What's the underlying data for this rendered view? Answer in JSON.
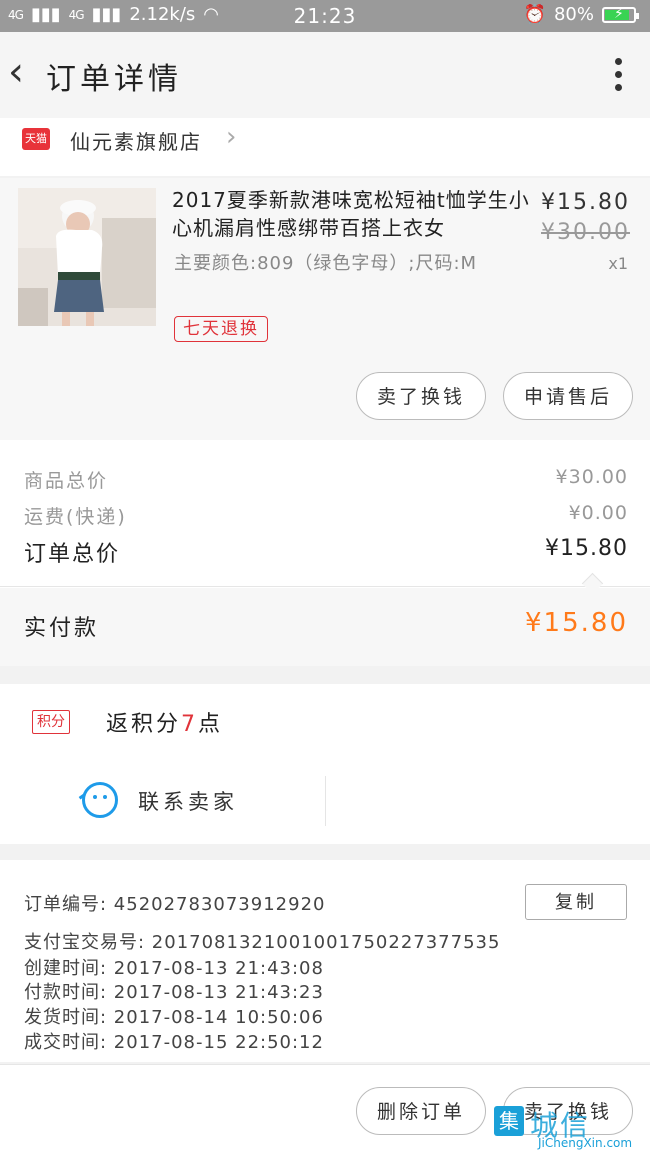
{
  "status_bar": {
    "signal1": "4G",
    "signal2": "4G",
    "speed": "2.12k/s",
    "time": "21:23",
    "battery": "80%"
  },
  "header": {
    "title": "订单详情"
  },
  "shop": {
    "badge": "天猫",
    "name": "仙元素旗舰店"
  },
  "product": {
    "title": "2017夏季新款港味宽松短袖t恤学生小心机漏肩性感绑带百搭上衣女",
    "variant": "主要颜色:809（绿色字母）;尺码:M",
    "tag": "七天退换",
    "price": "¥15.80",
    "original_price": "¥30.00",
    "quantity": "x1",
    "buttons": {
      "sell_again": "卖了换钱",
      "after_sale": "申请售后"
    }
  },
  "totals": {
    "goods_label": "商品总价",
    "goods_value": "¥30.00",
    "shipping_label": "运费(快递)",
    "shipping_value": "¥0.00",
    "order_label": "订单总价",
    "order_value": "¥15.80",
    "paid_label": "实付款",
    "paid_value": "¥15.80"
  },
  "points": {
    "badge": "积分",
    "text_prefix": "返积分",
    "value": "7",
    "text_suffix": "点"
  },
  "contact": {
    "label": "联系卖家"
  },
  "order_info": {
    "order_no": "订单编号:  45202783073912920",
    "alipay_no": "支付宝交易号:  2017081321001001750227377535",
    "created": "创建时间:  2017-08-13 21:43:08",
    "paid": "付款时间:  2017-08-13 21:43:23",
    "shipped": "发货时间:  2017-08-14 10:50:06",
    "completed": "成交时间:  2017-08-15 22:50:12",
    "copy_button": "复制"
  },
  "footer": {
    "delete_button": "删除订单",
    "sell_button": "卖了换钱"
  },
  "watermark": {
    "mark": "集",
    "text": "城信",
    "url": "JiChengXin.com"
  },
  "colors": {
    "accent_red": "#e0333a",
    "paid_orange": "#ff7a1a",
    "contact_blue": "#1e9be9"
  }
}
